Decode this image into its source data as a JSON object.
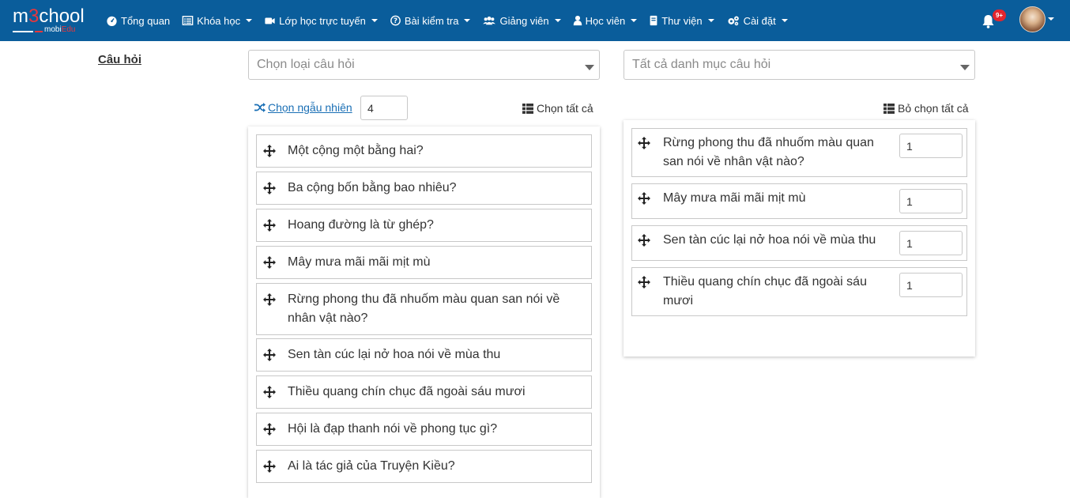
{
  "brand": {
    "logo_text_a": "m",
    "logo_text_red": "3",
    "logo_text_b": "chool",
    "logo_sub_a": "mobi",
    "logo_sub_red": "Edu"
  },
  "nav": {
    "items": [
      {
        "label": "Tổng quan",
        "icon": "dashboard-icon",
        "caret": false
      },
      {
        "label": "Khóa học",
        "icon": "list-icon",
        "caret": true
      },
      {
        "label": "Lớp học trực tuyến",
        "icon": "video-icon",
        "caret": true
      },
      {
        "label": "Bài kiểm tra",
        "icon": "question-circle-icon",
        "caret": true
      },
      {
        "label": "Giảng viên",
        "icon": "users-icon",
        "caret": true
      },
      {
        "label": "Học viên",
        "icon": "user-icon",
        "caret": true
      },
      {
        "label": "Thư viện",
        "icon": "book-icon",
        "caret": true
      },
      {
        "label": "Cài đặt",
        "icon": "cogs-icon",
        "caret": true
      }
    ],
    "notification_badge": "9+"
  },
  "page": {
    "section_title": "Câu hỏi",
    "type_select": "Chọn loại câu hỏi",
    "category_select": "Tất cả danh mục câu hỏi",
    "random_label": " Chọn ngẫu nhiên",
    "random_count": "4",
    "select_all": "Chọn tất cả",
    "deselect_all": "Bỏ chọn tất cả"
  },
  "available_questions": [
    "Một cộng một bằng hai?",
    "Ba cộng bốn bằng bao nhiêu?",
    "Hoang đường là từ ghép?",
    "Mây mưa mãi mãi mịt mù",
    "Rừng phong thu đã nhuốm màu quan san nói về nhân vật nào?",
    "Sen tàn cúc lại nở hoa nói về mùa thu",
    "Thiều quang chín chục đã ngoài sáu mươi",
    "Hội là đạp thanh nói về phong tục gì?",
    "Ai là tác giả của Truyện Kiều?"
  ],
  "selected_questions": [
    {
      "text": "Rừng phong thu đã nhuốm màu quan san nói về nhân vật nào?",
      "points": "1"
    },
    {
      "text": "Mây mưa mãi mãi mịt mù",
      "points": "1"
    },
    {
      "text": "Sen tàn cúc lại nở hoa nói về mùa thu",
      "points": "1"
    },
    {
      "text": "Thiều quang chín chục đã ngoài sáu mươi",
      "points": "1"
    }
  ],
  "colors": {
    "navbar": "#0a5d9b",
    "link": "#1a6fb5",
    "badge": "#e3262e"
  }
}
